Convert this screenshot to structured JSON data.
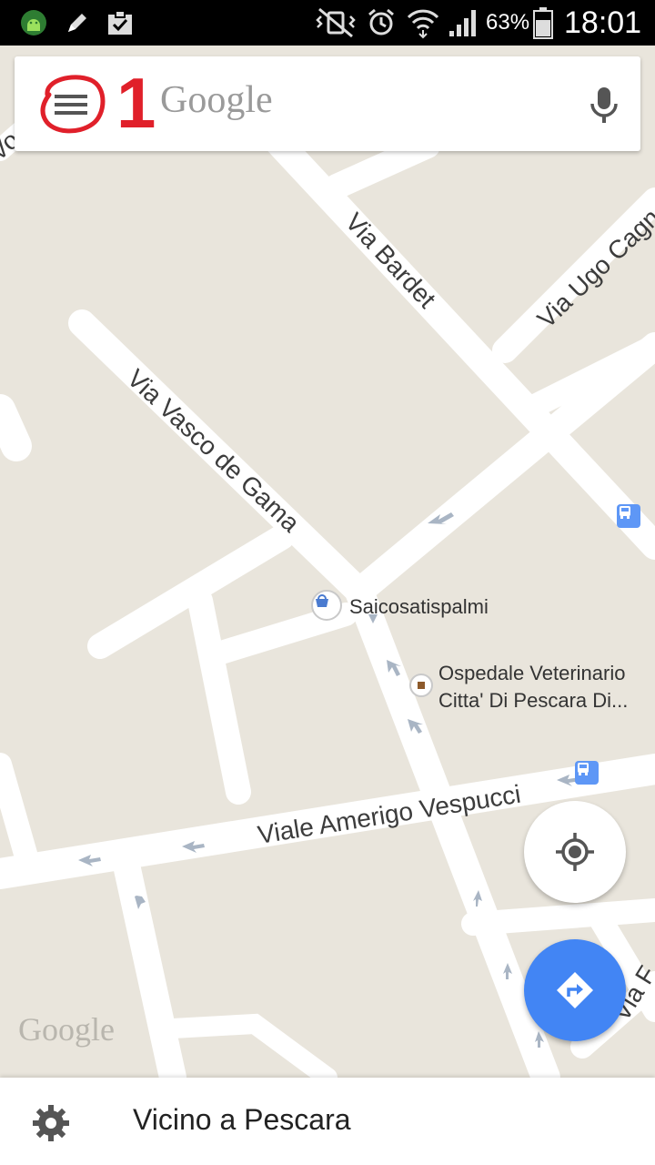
{
  "status_bar": {
    "battery_percent": "63%",
    "time": "18:01",
    "icons": [
      "android-debug-icon",
      "edit-icon",
      "clipboard-check-icon",
      "mute-vibrate-icon",
      "alarm-icon",
      "wifi-icon",
      "signal-icon",
      "battery-icon"
    ]
  },
  "search": {
    "wordmark": "Google",
    "annotation": "1",
    "menu_icon": "menu-icon",
    "mic_icon": "mic-icon"
  },
  "map": {
    "streets": {
      "via_bardet": "Via Bardet",
      "via_ugo_cagni": "Via Ugo Cagn",
      "via_vasco_de_gama": "Via Vasco de Gama",
      "viale_amerigo_vespucci": "Viale Amerigo Vespucci",
      "via_f": "Via F",
      "top_left_fragment": "Vo"
    },
    "pois": {
      "shop_name": "Saicosatispalmi",
      "hospital_line1": "Ospedale Veterinario",
      "hospital_line2": "Citta' Di Pescara Di..."
    },
    "watermark": "Google"
  },
  "bottom_bar": {
    "location_label": "Vicino a Pescara",
    "settings_icon": "gear-icon"
  },
  "colors": {
    "map_background": "#e9e5dc",
    "road": "#ffffff",
    "accent_blue": "#4285f4",
    "annotation_red": "#e0202a"
  }
}
